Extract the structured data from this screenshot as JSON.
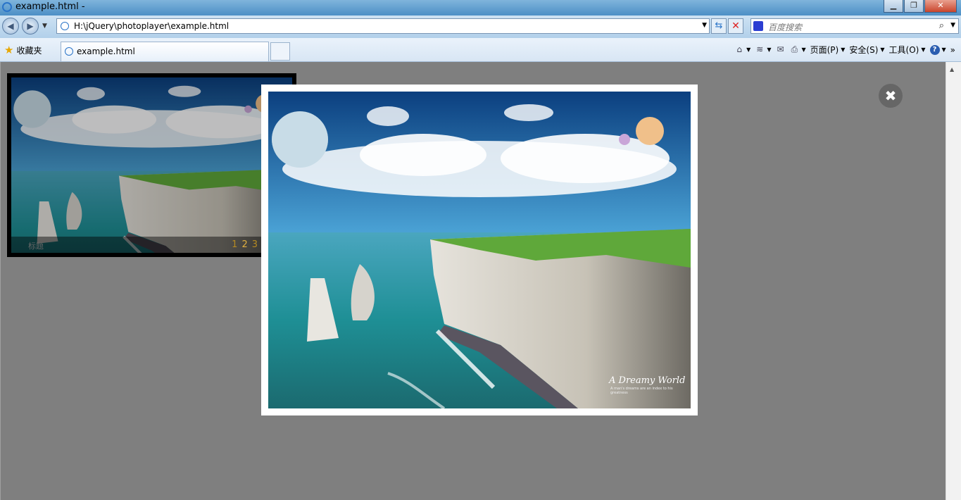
{
  "window": {
    "title": "example.html -",
    "minimize_glyph": "▁",
    "restore_glyph": "❐",
    "close_glyph": "✕"
  },
  "address": {
    "url": "H:\\jQuery\\photoplayer\\example.html",
    "back_glyph": "◀",
    "forward_glyph": "▶",
    "refresh_glyph": "⇆",
    "stop_glyph": "✕",
    "dropdown_glyph": "▼"
  },
  "search": {
    "placeholder": "百度搜索",
    "search_glyph": "⌕",
    "dropdown_glyph": "▼"
  },
  "tabs": {
    "favorites_label": "收藏夹",
    "active_tab_label": "example.html"
  },
  "commands": {
    "home_glyph": "⌂",
    "feeds_glyph": "≋",
    "mail_glyph": "✉",
    "print_glyph": "⎙",
    "page_label": "页面(P)",
    "safety_label": "安全(S)",
    "tools_label": "工具(O)",
    "help_glyph": "?",
    "caret_glyph": "▼",
    "more_glyph": "»"
  },
  "player": {
    "slide_numbers": [
      "1",
      "2",
      "3"
    ],
    "active_slide": 2,
    "caption": "标题"
  },
  "lightbox": {
    "watermark_title": "A Dreamy World",
    "watermark_sub": "A man's dreams are an index to his greatness",
    "close_glyph": "✖"
  },
  "colors": {
    "page_overlay": "#7f7f7f",
    "chrome_blue": "#4c8fc6",
    "sky_top": "#0c4f92",
    "sea": "#1f9a9a",
    "grass": "#5fa83a"
  }
}
